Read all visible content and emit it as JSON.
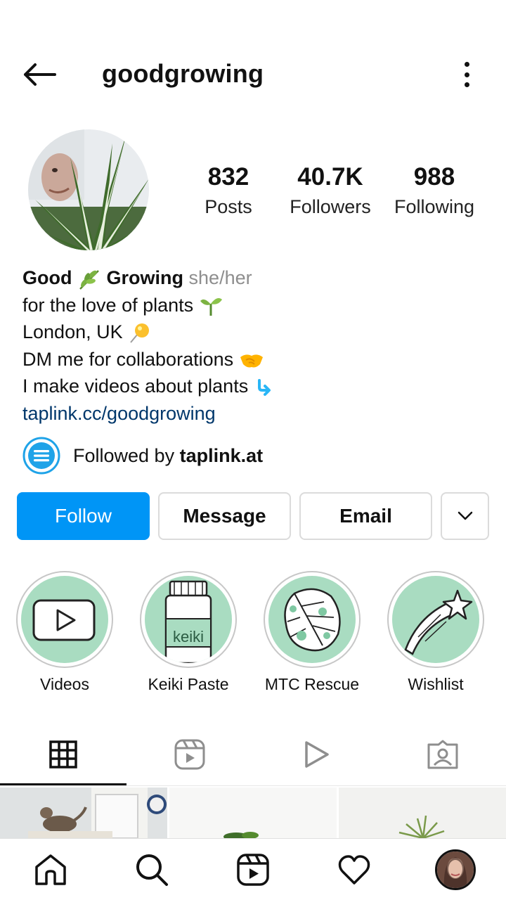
{
  "header": {
    "username": "goodgrowing"
  },
  "stats": [
    {
      "value": "832",
      "label": "Posts"
    },
    {
      "value": "40.7K",
      "label": "Followers"
    },
    {
      "value": "988",
      "label": "Following"
    }
  ],
  "bio": {
    "name_part1": "Good",
    "name_part2": "Growing",
    "pronouns": "she/her",
    "line1": "for the love of plants",
    "line2": "London, UK",
    "line3": "DM me for collaborations",
    "line4": "I make videos about plants",
    "link": "taplink.cc/goodgrowing"
  },
  "followed_by": {
    "prefix": "Followed by ",
    "account": "taplink.at"
  },
  "actions": {
    "follow": "Follow",
    "message": "Message",
    "email": "Email"
  },
  "highlights": [
    {
      "label": "Videos"
    },
    {
      "label": "Keiki Paste",
      "bottle_text": "keiki"
    },
    {
      "label": "MTC Rescue"
    },
    {
      "label": "Wishlist"
    }
  ],
  "colors": {
    "accent": "#0095f6",
    "link": "#00376b",
    "highlight_bg": "#a9dcc1",
    "muted": "#8e8e8e"
  },
  "icons": {
    "back": "arrow-left-icon",
    "more": "more-vertical-icon",
    "grid": "grid-icon",
    "reels": "reels-icon",
    "video": "play-icon",
    "tagged": "tagged-icon",
    "home": "home-icon",
    "search": "search-icon",
    "heart": "heart-icon"
  }
}
